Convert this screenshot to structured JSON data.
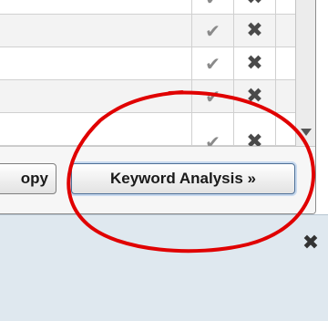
{
  "grid": {
    "rows": [
      {
        "check_icon": "✔",
        "cross_icon": "✖"
      },
      {
        "check_icon": "✔",
        "cross_icon": "✖"
      },
      {
        "check_icon": "✔",
        "cross_icon": "✖"
      },
      {
        "check_icon": "✔",
        "cross_icon": "✖"
      },
      {
        "check_icon": "✔",
        "cross_icon": "✖"
      }
    ]
  },
  "toolbar": {
    "copy_label": "opy",
    "keyword_analysis_label": "Keyword Analysis »"
  },
  "lower_panel": {
    "close_icon": "✖"
  },
  "annotation": {
    "color": "#e00000"
  },
  "icons": {
    "check": "check-icon",
    "cross": "cross-icon",
    "close": "close-icon",
    "scroll_down": "chevron-down-icon"
  }
}
